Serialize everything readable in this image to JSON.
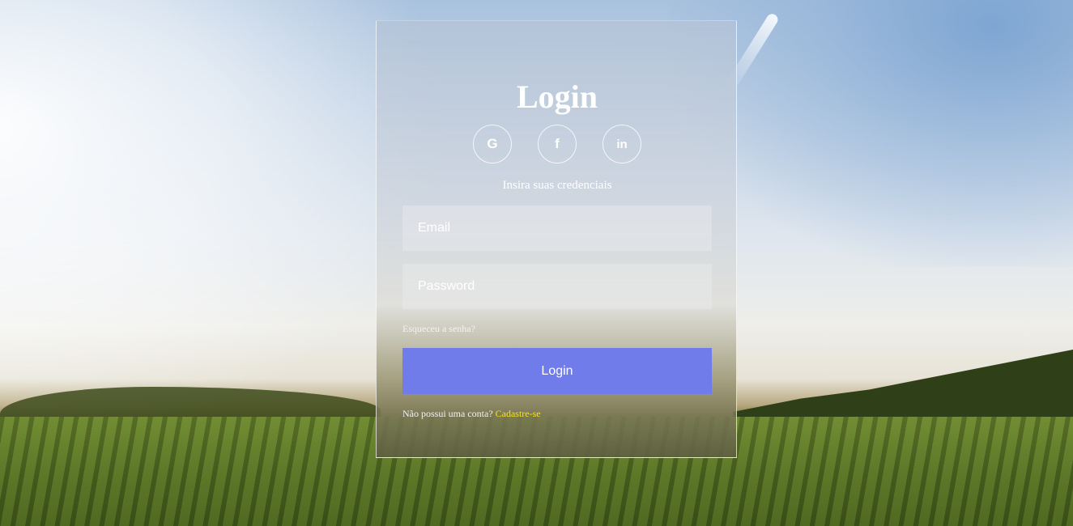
{
  "card": {
    "title": "Login",
    "subtitle": "Insira suas credenciais"
  },
  "socials": [
    {
      "icon": "google-icon",
      "glyph": "G"
    },
    {
      "icon": "facebook-icon",
      "glyph": "f"
    },
    {
      "icon": "linkedin-icon",
      "glyph": "in"
    }
  ],
  "form": {
    "email_placeholder": "Email",
    "email_value": "",
    "password_placeholder": "Password",
    "password_value": "",
    "forgot_label": "Esqueceu a senha?",
    "login_label": "Login",
    "signup_prompt": "Não possui uma conta?",
    "signup_link": "Cadastre-se"
  },
  "colors": {
    "login_button": "#717ceb",
    "signup_link": "#f5e21b"
  }
}
